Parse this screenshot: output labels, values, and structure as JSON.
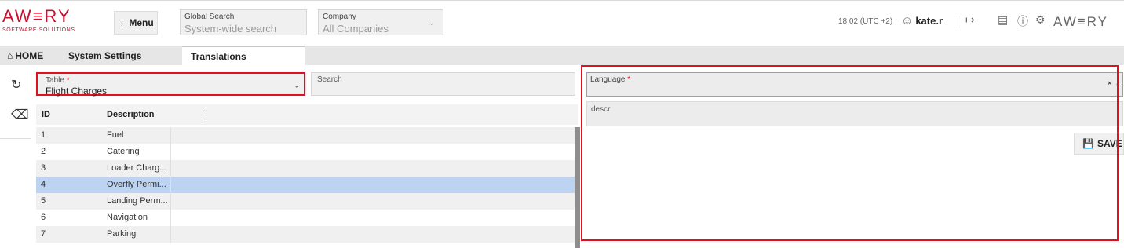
{
  "brand": {
    "logo_word": "AW≡RY",
    "logo_sub": "SOFTWARE SOLUTIONS",
    "logo_right": "AW≡RY"
  },
  "header": {
    "menu_label": "Menu",
    "global_search": {
      "label": "Global Search",
      "placeholder": "System-wide search"
    },
    "company": {
      "label": "Company",
      "value": "All Companies"
    },
    "time": "18:02 (UTC +2)",
    "user": "kate.r"
  },
  "tabs": [
    {
      "label": "HOME"
    },
    {
      "label": "System Settings"
    },
    {
      "label": "Translations"
    }
  ],
  "table_select": {
    "label": "Table",
    "required_mark": "*",
    "value": "Flight Charges"
  },
  "search": {
    "label": "Search"
  },
  "grid": {
    "columns": [
      "ID",
      "Description"
    ],
    "rows": [
      {
        "id": "1",
        "description": "Fuel",
        "selected": false
      },
      {
        "id": "2",
        "description": "Catering",
        "selected": false
      },
      {
        "id": "3",
        "description": "Loader Charg...",
        "selected": false
      },
      {
        "id": "4",
        "description": "Overfly Permi...",
        "selected": true
      },
      {
        "id": "5",
        "description": "Landing Perm...",
        "selected": false
      },
      {
        "id": "6",
        "description": "Navigation",
        "selected": false
      },
      {
        "id": "7",
        "description": "Parking",
        "selected": false
      }
    ]
  },
  "language": {
    "label": "Language",
    "required_mark": "*"
  },
  "descr": {
    "label": "descr"
  },
  "save_label": "SAVE",
  "colors": {
    "accent_red": "#e0101e",
    "selected_row": "#bcd4f2",
    "zebra": "#f0f0f0"
  }
}
